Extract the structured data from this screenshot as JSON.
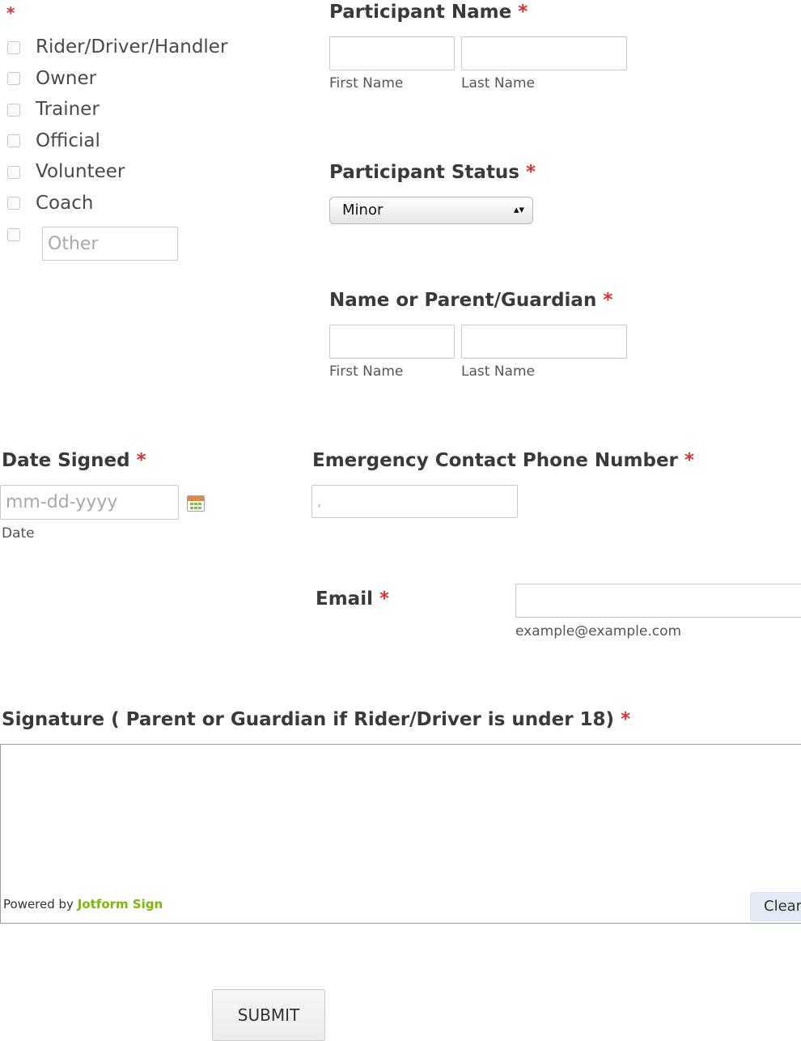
{
  "role_group": {
    "required_mark": "*",
    "options": [
      "Rider/Driver/Handler",
      "Owner",
      "Trainer",
      "Official",
      "Volunteer",
      "Coach"
    ],
    "other_placeholder": "Other"
  },
  "participant_name": {
    "label": "Participant Name",
    "required_mark": "*",
    "first_sublabel": "First Name",
    "last_sublabel": "Last Name"
  },
  "participant_status": {
    "label": "Participant Status",
    "required_mark": "*",
    "selected": "Minor"
  },
  "guardian_name": {
    "label": "Name or Parent/Guardian",
    "required_mark": "*",
    "first_sublabel": "First Name",
    "last_sublabel": "Last Name"
  },
  "date_signed": {
    "label": "Date Signed",
    "required_mark": "*",
    "placeholder": "mm-dd-yyyy",
    "sublabel": "Date"
  },
  "emergency_phone": {
    "label": "Emergency Contact Phone Number",
    "required_mark": "*",
    "placeholder": ","
  },
  "email": {
    "label": "Email",
    "required_mark": "*",
    "sublabel": "example@example.com"
  },
  "signature": {
    "label": "Signature ( Parent or Guardian if Rider/Driver is under 18)",
    "required_mark": "*",
    "powered_prefix": "Powered by",
    "powered_brand": "Jotform Sign",
    "clear_label": "Clear"
  },
  "submit_label": "SUBMIT",
  "colors": {
    "required": "#e03131",
    "brand_green": "#78bb07",
    "clear_button_bg": "#e3ebf6"
  },
  "icons": {
    "calendar": "calendar-icon",
    "select_arrows": "updown-arrows-icon"
  }
}
